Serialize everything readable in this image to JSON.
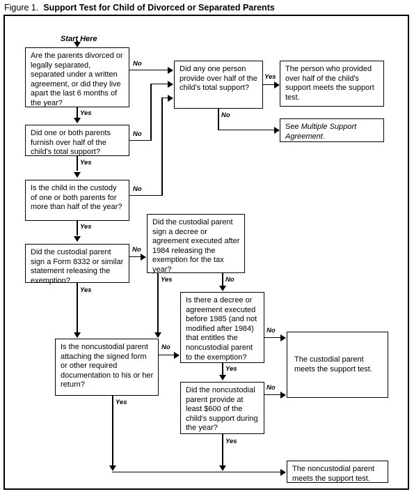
{
  "figure": {
    "label": "Figure 1.",
    "title": "Support Test for Child of Divorced or Separated Parents",
    "start_label": "Start Here"
  },
  "nodes": {
    "q_divorced": "Are the parents divorced or legally separated, separated under a written agreement, or did they live apart the last 6 months of the year?",
    "q_furnish_half": "Did one or both parents furnish over half of the child's total support?",
    "q_custody": "Is the child in the custody of one or both parents for more than half of the year?",
    "q_form8332": "Did the custodial parent sign a Form 8332 or similar statement releasing the exemption?",
    "q_any_one_person": "Did any one person provide over half of the child's total support?",
    "r_person_provided": "The person who provided over half of the child's support meets the support test.",
    "r_multiple_support_pre": "See ",
    "r_multiple_support_em": "Multiple Support Agreement",
    "r_multiple_support_post": ".",
    "q_decree_after_1984": "Did the custodial parent sign a decree or agreement executed after 1984 releasing the exemption for the tax year?",
    "q_decree_before_1985": "Is there a decree or agreement executed before 1985 (and not modified after 1984) that entitles the noncustodial parent to the exemption?",
    "q_attaching_form": "Is the noncustodial parent attaching the signed form or other required documentation to his or her return?",
    "q_600_support": "Did the noncustodial parent provide at least $600 of the child's support during the year?",
    "r_custodial_meets": "The custodial parent meets the support test.",
    "r_noncustodial_meets": "The noncustodial parent meets the support test."
  },
  "edge_labels": {
    "no_1": "No",
    "yes_1": "Yes",
    "no_2": "No",
    "yes_2": "Yes",
    "no_3": "No",
    "yes_3": "Yes",
    "no_4": "No",
    "yes_4": "Yes",
    "yes_any": "Yes",
    "no_any": "No",
    "yes_decree84": "Yes",
    "no_decree84": "No",
    "no_decree85": "No",
    "yes_decree85": "Yes",
    "no_attach": "No",
    "yes_attach": "Yes",
    "no_600": "No",
    "yes_600": "Yes"
  },
  "colors": {
    "line": "#000000",
    "background": "#ffffff",
    "text": "#000000"
  }
}
